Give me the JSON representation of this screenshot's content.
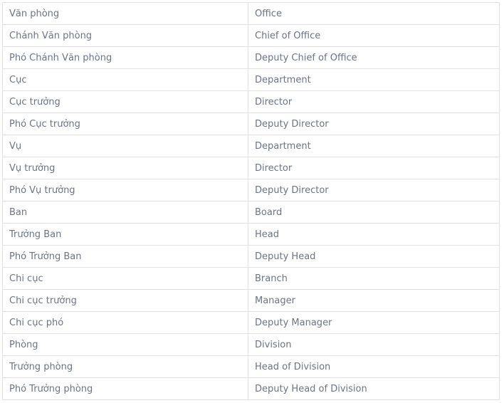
{
  "document": {
    "type": "glossary-table",
    "columns": [
      "Vietnamese",
      "English"
    ],
    "header_visible": false,
    "colors": {
      "text": "#6d7480",
      "border": "#e2e2e2",
      "background": "#ffffff"
    },
    "rows": [
      {
        "vi": "Văn phòng",
        "en": "Office"
      },
      {
        "vi": "Chánh Văn phòng",
        "en": "Chief of Office"
      },
      {
        "vi": "Phó Chánh Văn phòng",
        "en": "Deputy Chief of Office"
      },
      {
        "vi": "Cục",
        "en": "Department"
      },
      {
        "vi": "Cục trưởng",
        "en": "Director"
      },
      {
        "vi": "Phó Cục trưởng",
        "en": "Deputy Director"
      },
      {
        "vi": "Vụ",
        "en": "Department"
      },
      {
        "vi": "Vụ trưởng",
        "en": "Director"
      },
      {
        "vi": "Phó Vụ trưởng",
        "en": "Deputy Director"
      },
      {
        "vi": "Ban",
        "en": "Board"
      },
      {
        "vi": "Trưởng Ban",
        "en": "Head"
      },
      {
        "vi": "Phó Trưởng Ban",
        "en": "Deputy Head"
      },
      {
        "vi": "Chi cục",
        "en": "Branch"
      },
      {
        "vi": "Chi cục trưởng",
        "en": "Manager"
      },
      {
        "vi": "Chi cục phó",
        "en": "Deputy Manager"
      },
      {
        "vi": "Phòng",
        "en": "Division"
      },
      {
        "vi": "Trưởng phòng",
        "en": "Head of Division"
      },
      {
        "vi": "Phó Trưởng phòng",
        "en": "Deputy Head of Division"
      }
    ]
  }
}
